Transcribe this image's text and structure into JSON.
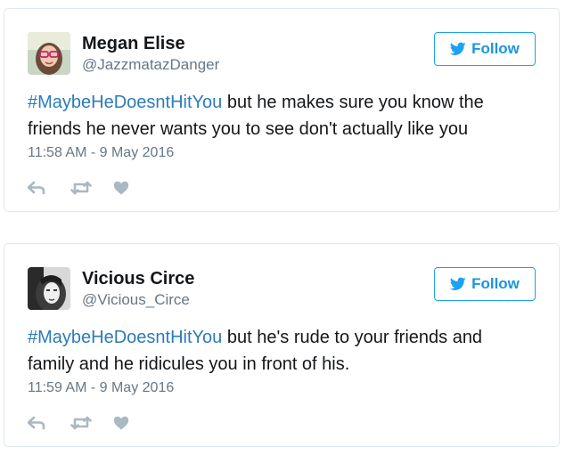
{
  "colors": {
    "accent": "#1da1f2",
    "hashtag": "#2b7bb9",
    "secondary_text": "#657786",
    "border": "#e1e8ed",
    "icon": "#aab8c2"
  },
  "tweets": [
    {
      "name": "Megan Elise",
      "handle": "@JazzmatazDanger",
      "follow_label": "Follow",
      "hashtag": "#MaybeHeDoesntHitYou",
      "text": " but he makes sure you know the friends he never wants you to see don't actually like you",
      "timestamp": "11:58 AM - 9 May 2016",
      "icons": [
        "reply-icon",
        "retweet-icon",
        "like-icon"
      ]
    },
    {
      "name": "Vicious Circe",
      "handle": "@Vicious_Circe",
      "follow_label": "Follow",
      "hashtag": "#MaybeHeDoesntHitYou",
      "text": " but he's rude to your friends and family and he ridicules you in front of his.",
      "timestamp": "11:59 AM - 9 May 2016",
      "icons": [
        "reply-icon",
        "retweet-icon",
        "like-icon"
      ]
    }
  ]
}
